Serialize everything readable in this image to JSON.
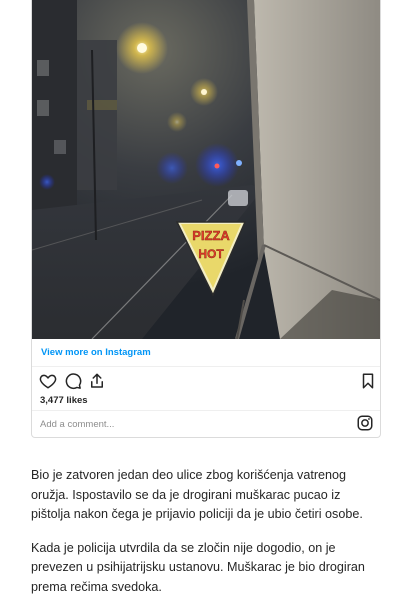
{
  "embed": {
    "view_more": "View more on Instagram",
    "likes": "3,477 likes",
    "comment_placeholder": "Add a comment...",
    "sign_lines": [
      "PIZZA",
      "HOT"
    ]
  },
  "article": {
    "paragraphs": [
      "Bio je zatvoren jedan deo ulice zbog korišćenja vatrenog oružja. Ispostavilo se da je drogirani muškarac pucao iz pištolja nakon čega je prijavio policiji da je ubio četiri osobe.",
      "Kada je policija utvrdila da se zločin nije dogodio, on je prevezen u psihijatrijsku ustanovu. Muškarac je bio drogiran prema rečima svedoka."
    ]
  }
}
